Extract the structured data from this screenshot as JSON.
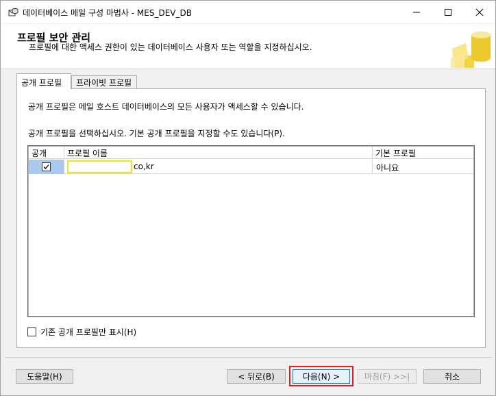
{
  "window": {
    "title": "데이터베이스 메일 구성 마법사 - MES_DEV_DB"
  },
  "header": {
    "title": "프로필 보안 관리",
    "description": "프로필에 대한 액세스 권한이 있는 데이터베이스 사용자 또는 역할을 지정하십시오."
  },
  "tabs": [
    {
      "label": "공개 프로필",
      "active": true
    },
    {
      "label": "프라이빗 프로필",
      "active": false
    }
  ],
  "panel": {
    "description1": "공개 프로필은 메일 호스트 데이터베이스의 모든 사용자가 액세스할 수 있습니다.",
    "description2": "공개 프로필을 선택하십시오. 기본 공개 프로필을 지정할 수도 있습니다(P)."
  },
  "grid": {
    "columns": [
      "공개",
      "프로필 이름",
      "기본 프로필"
    ],
    "rows": [
      {
        "public": true,
        "name_suffix": "co,kr",
        "default": "아니요"
      }
    ]
  },
  "existing_only": {
    "label": "기존 공개 프로필만 표시(H)",
    "checked": false
  },
  "buttons": {
    "help": "도움말(H)",
    "back": "< 뒤로(B)",
    "next": "다음(N) >",
    "finish": "마침(F) >>|",
    "cancel": "취소"
  },
  "colors": {
    "highlight_outline": "#e02020",
    "name_edit_border": "#f5e21a",
    "selected_cell": "#a8c8ee"
  }
}
